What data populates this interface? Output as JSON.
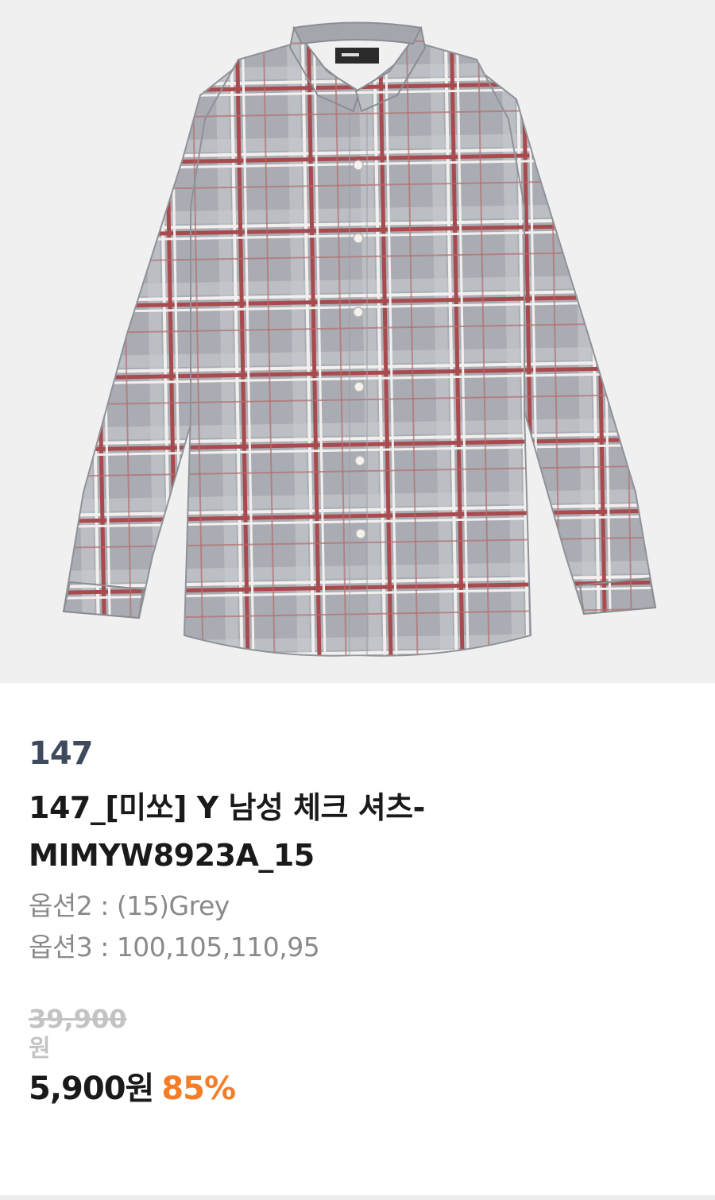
{
  "product": {
    "image_alt": "grey-red-check-shirt",
    "brand": "147",
    "title": "147_[미쏘] Y 남성 체크 셔츠-MIMYW8923A_15",
    "options": [
      {
        "label": "옵션2 : (15)Grey"
      },
      {
        "label": "옵션3 : 100,105,110,95"
      }
    ],
    "original_price": "39,900",
    "original_currency": "원",
    "sale_price": "5,900원",
    "discount": "85%"
  },
  "colors": {
    "discount": "#f57d28",
    "brand": "#3e4a5e",
    "shirt_base": "#a9adb3",
    "check_red": "#a94a4f",
    "check_white": "#f2f0ee",
    "background": "#f0f0f0"
  }
}
